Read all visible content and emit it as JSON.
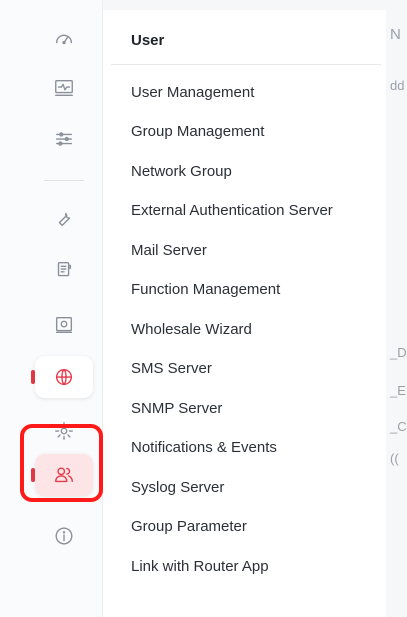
{
  "menu": {
    "header": "User",
    "items": [
      "User Management",
      "Group Management",
      "Network Group",
      "External Authentication Server",
      "Mail Server",
      "Function Management",
      "Wholesale Wizard",
      "SMS Server",
      "SNMP Server",
      "Notifications & Events",
      "Syslog Server",
      "Group Parameter",
      "Link with Router App"
    ]
  },
  "sidebar": {
    "icons": [
      "dashboard-gauge-icon",
      "monitor-pulse-icon",
      "sliders-icon",
      "wrench-icon",
      "document-icon",
      "settings-panel-icon",
      "globe-icon",
      "gear-icon",
      "users-icon",
      "info-icon"
    ],
    "active_color": "#e53946"
  },
  "background_fragments": [
    "N",
    "dd",
    "_D",
    "_E",
    "_C",
    "(("
  ]
}
